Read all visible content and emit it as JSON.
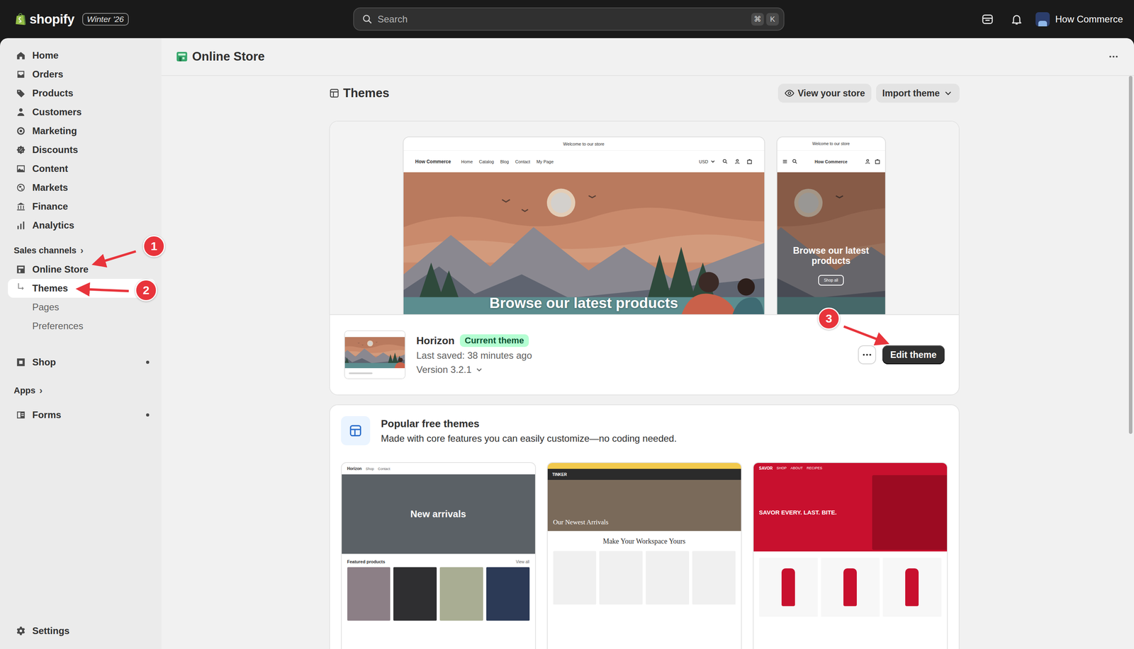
{
  "topbar": {
    "logo": "shopify",
    "edition": "Winter '26",
    "search_placeholder": "Search",
    "shortcut": [
      "⌘",
      "K"
    ],
    "store_name": "How Commerce"
  },
  "sidebar": {
    "items": [
      {
        "label": "Home",
        "selected": false
      },
      {
        "label": "Orders",
        "selected": false
      },
      {
        "label": "Products",
        "selected": false
      },
      {
        "label": "Customers",
        "selected": false
      },
      {
        "label": "Marketing",
        "selected": false
      },
      {
        "label": "Discounts",
        "selected": false
      },
      {
        "label": "Content",
        "selected": false
      },
      {
        "label": "Markets",
        "selected": false
      },
      {
        "label": "Finance",
        "selected": false
      },
      {
        "label": "Analytics",
        "selected": false
      }
    ],
    "sales_channels": {
      "heading": "Sales channels",
      "chevron": "›"
    },
    "channel": {
      "label": "Online Store",
      "selected": false
    },
    "sub_items": [
      {
        "label": "Themes",
        "selected": true
      },
      {
        "label": "Pages",
        "selected": false
      },
      {
        "label": "Preferences",
        "selected": false
      }
    ],
    "pinned_channels": [
      {
        "label": "Shop",
        "dot": true
      }
    ],
    "apps": {
      "heading": "Apps",
      "chevron": "›"
    },
    "pinned_apps": [
      {
        "label": "Forms",
        "dot": true
      }
    ],
    "settings": {
      "label": "Settings"
    }
  },
  "page": {
    "title": "Online Store"
  },
  "themes": {
    "title": "Themes",
    "actions": [
      {
        "label": "View your store",
        "kind": "view"
      },
      {
        "label": "Import theme",
        "kind": "dropdown"
      }
    ],
    "preview": {
      "announcement": "Welcome to our store",
      "store": "How Commerce",
      "nav": [
        "Home",
        "Catalog",
        "Blog",
        "Contact",
        "My Page"
      ],
      "currency": "USD",
      "headline": "Browse our latest products",
      "button": "Shop all"
    },
    "current": {
      "name": "Horizon",
      "badge": "Current theme",
      "last_saved": "Last saved: 38 minutes ago",
      "version": "Version 3.2.1",
      "edit": "Edit theme"
    },
    "popular": {
      "title": "Popular free themes",
      "subtitle": "Made with core features you can easily customize—no coding needed.",
      "themes": [
        {
          "name": "Horizon",
          "kind": "horizon",
          "nav": [
            "Shop",
            "Contact"
          ],
          "hero_text": "New arrivals",
          "section": "Featured products",
          "link": "View all",
          "color": "#5b6166"
        },
        {
          "name": "TINKER",
          "kind": "tinker",
          "nav": [],
          "hero_text": "Our Newest Arrivals",
          "section": "Make Your Workspace Yours",
          "link": "",
          "color": "#f2c94c"
        },
        {
          "name": "SAVOR",
          "kind": "savor",
          "nav": [
            "SHOP",
            "ABOUT",
            "RECIPES"
          ],
          "hero_text": "SAVOR EVERY. LAST. BITE.",
          "section": "",
          "link": "",
          "color": "#c8102e"
        }
      ]
    }
  },
  "annotations": [
    {
      "number": "1"
    },
    {
      "number": "2"
    },
    {
      "number": "3"
    }
  ]
}
